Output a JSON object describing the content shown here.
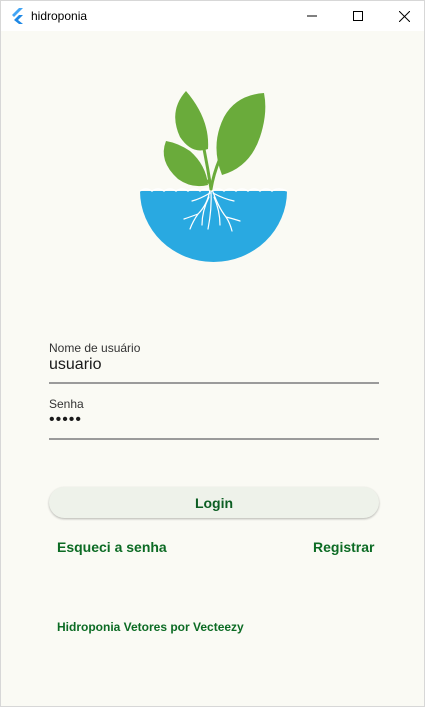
{
  "window": {
    "title": "hidroponia"
  },
  "form": {
    "username_label": "Nome de usuário",
    "username_value": "usuario",
    "password_label": "Senha",
    "password_value": "•••••"
  },
  "actions": {
    "login_label": "Login",
    "forgot_label": "Esqueci a senha",
    "register_label": "Registrar"
  },
  "credit": "Hidroponia Vetores por Vecteezy",
  "colors": {
    "accent": "#0c6b24",
    "water": "#29a9e1",
    "leaf": "#6aab3b",
    "background": "#fafaf4"
  }
}
